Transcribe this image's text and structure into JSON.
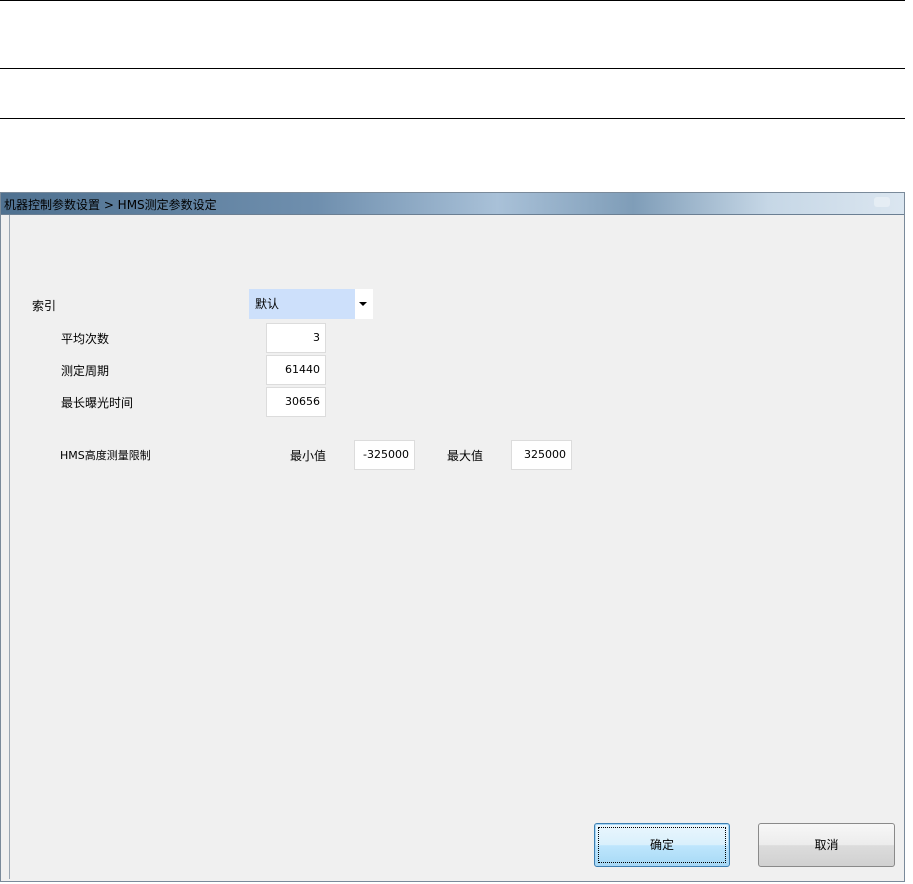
{
  "dialog": {
    "title": "机器控制参数设置 > HMS测定参数设定"
  },
  "form": {
    "index": {
      "label": "索引",
      "selected": "默认"
    },
    "avg_count": {
      "label": "平均次数",
      "value": "3"
    },
    "measure_period": {
      "label": "测定周期",
      "value": "61440"
    },
    "max_exposure": {
      "label": "最长曝光时间",
      "value": "30656"
    },
    "hms_limit": {
      "label": "HMS高度测量限制",
      "min_label": "最小值",
      "min_value": "-325000",
      "max_label": "最大值",
      "max_value": "325000"
    }
  },
  "buttons": {
    "ok": "确定",
    "cancel": "取消"
  }
}
